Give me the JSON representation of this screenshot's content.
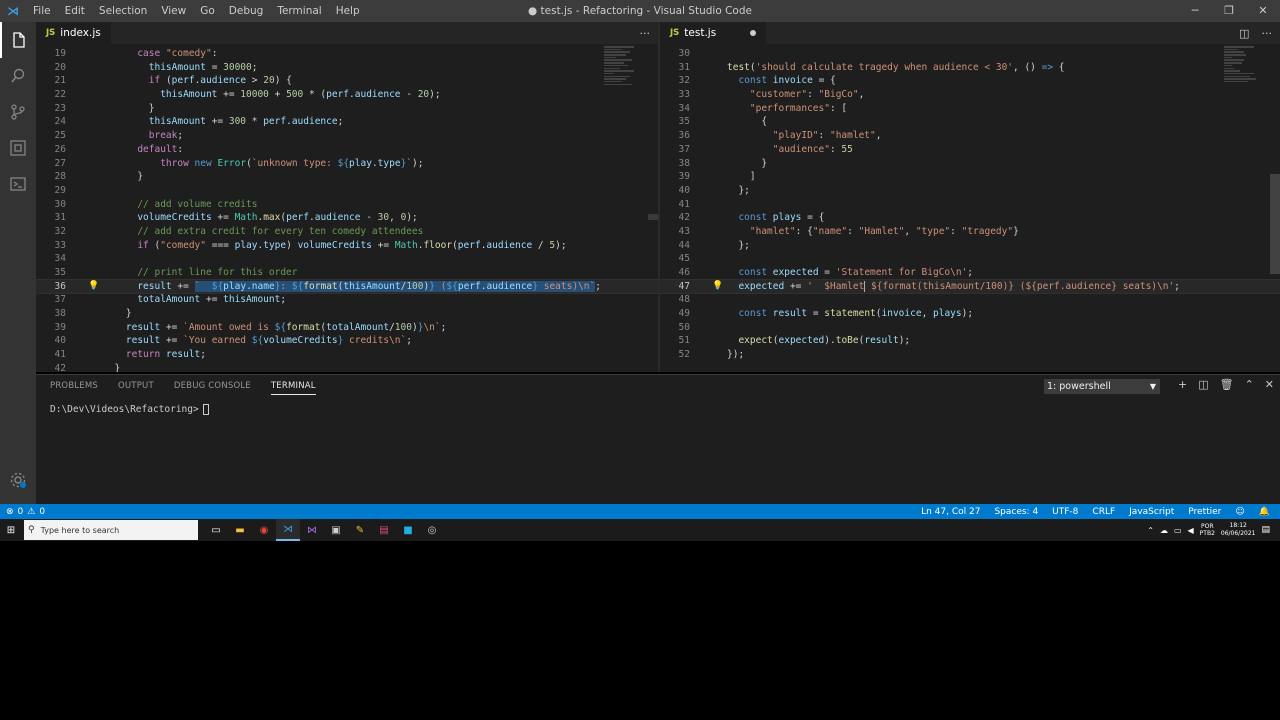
{
  "window": {
    "title": "● test.js - Refactoring - Visual Studio Code",
    "menu": [
      "File",
      "Edit",
      "Selection",
      "View",
      "Go",
      "Debug",
      "Terminal",
      "Help"
    ]
  },
  "activity_icons": [
    "files-icon",
    "search-icon",
    "source-control-icon",
    "extensions-icon",
    "remote-explorer-icon"
  ],
  "editor_left": {
    "tab_label": "index.js",
    "lines": [
      {
        "n": "19",
        "html": "      <span class=\"kw\">case</span> <span class=\"str\">\"comedy\"</span>:"
      },
      {
        "n": "20",
        "html": "        <span class=\"var\">thisAmount</span> = <span class=\"num2\">30000</span>;"
      },
      {
        "n": "21",
        "html": "        <span class=\"kw\">if</span> (<span class=\"var\">perf</span>.<span class=\"var\">audience</span> > <span class=\"num2\">20</span>) {"
      },
      {
        "n": "22",
        "html": "          <span class=\"var\">thisAmount</span> += <span class=\"num2\">10000</span> + <span class=\"num2\">500</span> * (<span class=\"var\">perf</span>.<span class=\"var\">audience</span> - <span class=\"num2\">20</span>);"
      },
      {
        "n": "23",
        "html": "        }"
      },
      {
        "n": "24",
        "html": "        <span class=\"var\">thisAmount</span> += <span class=\"num2\">300</span> * <span class=\"var\">perf</span>.<span class=\"var\">audience</span>;"
      },
      {
        "n": "25",
        "html": "        <span class=\"kw\">break</span>;"
      },
      {
        "n": "26",
        "html": "      <span class=\"kw\">default</span>:"
      },
      {
        "n": "27",
        "html": "          <span class=\"kw\">throw</span> <span class=\"kw2\">new</span> <span class=\"cls\">Error</span>(<span class=\"str\">`unknown type: </span><span class=\"kw2\">${</span><span class=\"var\">play</span>.<span class=\"var\">type</span><span class=\"kw2\">}</span><span class=\"str\">`</span>);"
      },
      {
        "n": "28",
        "html": "      }"
      },
      {
        "n": "29",
        "html": ""
      },
      {
        "n": "30",
        "html": "      <span class=\"com\">// add volume credits</span>"
      },
      {
        "n": "31",
        "html": "      <span class=\"var\">volumeCredits</span> += <span class=\"cls\">Math</span>.<span class=\"fn\">max</span>(<span class=\"var\">perf</span>.<span class=\"var\">audience</span> - <span class=\"num2\">30</span>, <span class=\"num2\">0</span>);"
      },
      {
        "n": "32",
        "html": "      <span class=\"com\">// add extra credit for every ten comedy attendees</span>"
      },
      {
        "n": "33",
        "html": "      <span class=\"kw\">if</span> (<span class=\"str\">\"comedy\"</span> === <span class=\"var\">play</span>.<span class=\"var\">type</span>) <span class=\"var\">volumeCredits</span> += <span class=\"cls\">Math</span>.<span class=\"fn\">floor</span>(<span class=\"var\">perf</span>.<span class=\"var\">audience</span> / <span class=\"num2\">5</span>);"
      },
      {
        "n": "34",
        "html": ""
      },
      {
        "n": "35",
        "html": "      <span class=\"com\">// print line for this order</span>"
      },
      {
        "n": "36",
        "html": "      <span class=\"var\">result</span> += <span class=\"sel\"><span class=\"str\">`  </span><span class=\"kw2\">${</span><span class=\"var\">play</span>.<span class=\"var\">name</span><span class=\"kw2\">}</span><span class=\"str\">: </span><span class=\"kw2\">${</span><span class=\"fn\">format</span>(<span class=\"var\">thisAmount</span>/<span class=\"num2\">100</span>)<span class=\"kw2\">}</span><span class=\"str\"> (</span><span class=\"kw2\">${</span><span class=\"var\">perf</span>.<span class=\"var\">audience</span><span class=\"kw2\">}</span><span class=\"str\"> seats)\\n`</span></span>;",
        "current": true,
        "bulb": true
      },
      {
        "n": "37",
        "html": "      <span class=\"var\">totalAmount</span> += <span class=\"var\">thisAmount</span>;"
      },
      {
        "n": "38",
        "html": "    }"
      },
      {
        "n": "39",
        "html": "    <span class=\"var\">result</span> += <span class=\"str\">`Amount owed is </span><span class=\"kw2\">${</span><span class=\"fn\">format</span>(<span class=\"var\">totalAmount</span>/<span class=\"num2\">100</span>)<span class=\"kw2\">}</span><span class=\"str\">\\n`</span>;"
      },
      {
        "n": "40",
        "html": "    <span class=\"var\">result</span> += <span class=\"str\">`You earned </span><span class=\"kw2\">${</span><span class=\"var\">volumeCredits</span><span class=\"kw2\">}</span><span class=\"str\"> credits\\n`</span>;"
      },
      {
        "n": "41",
        "html": "    <span class=\"kw\">return</span> <span class=\"var\">result</span>;"
      },
      {
        "n": "42",
        "html": "  }"
      }
    ]
  },
  "editor_right": {
    "tab_label": "test.js",
    "lines": [
      {
        "n": "30",
        "html": ""
      },
      {
        "n": "31",
        "html": "<span class=\"fn\">test</span>(<span class=\"str\">'should calculate tragedy when audience &lt; 30'</span>, () <span class=\"kw2\">=></span> {"
      },
      {
        "n": "32",
        "html": "  <span class=\"kw2\">const</span> <span class=\"var\">invoice</span> = {"
      },
      {
        "n": "33",
        "html": "    <span class=\"str\">\"customer\"</span>: <span class=\"str\">\"BigCo\"</span>,"
      },
      {
        "n": "34",
        "html": "    <span class=\"str\">\"performances\"</span>: ["
      },
      {
        "n": "35",
        "html": "      {"
      },
      {
        "n": "36",
        "html": "        <span class=\"str\">\"playID\"</span>: <span class=\"str\">\"hamlet\"</span>,"
      },
      {
        "n": "37",
        "html": "        <span class=\"str\">\"audience\"</span>: <span class=\"num2\">55</span>"
      },
      {
        "n": "38",
        "html": "      }"
      },
      {
        "n": "39",
        "html": "    ]"
      },
      {
        "n": "40",
        "html": "  };"
      },
      {
        "n": "41",
        "html": ""
      },
      {
        "n": "42",
        "html": "  <span class=\"kw2\">const</span> <span class=\"var\">plays</span> = {"
      },
      {
        "n": "43",
        "html": "    <span class=\"str\">\"hamlet\"</span>: {<span class=\"str\">\"name\"</span>: <span class=\"str\">\"Hamlet\"</span>, <span class=\"str\">\"type\"</span>: <span class=\"str\">\"tragedy\"</span>}"
      },
      {
        "n": "44",
        "html": "  };"
      },
      {
        "n": "45",
        "html": ""
      },
      {
        "n": "46",
        "html": "  <span class=\"kw2\">const</span> <span class=\"var\">expected</span> = <span class=\"str\">'Statement for BigCo\\n'</span>;"
      },
      {
        "n": "47",
        "html": "  <span class=\"var\">expected</span> += <span class=\"str\">'  $Hamlet</span><span style=\"border-left:1px solid #aeafad\"></span><span class=\"str\"> ${format(thisAmount/100)} (${perf.audience} seats)\\n'</span>;",
        "current": true,
        "bulb": true
      },
      {
        "n": "48",
        "html": ""
      },
      {
        "n": "49",
        "html": "  <span class=\"kw2\">const</span> <span class=\"var\">result</span> = <span class=\"fn\">statement</span>(<span class=\"var\">invoice</span>, <span class=\"var\">plays</span>);"
      },
      {
        "n": "50",
        "html": ""
      },
      {
        "n": "51",
        "html": "  <span class=\"fn\">expect</span>(<span class=\"var\">expected</span>).<span class=\"fn\">toBe</span>(<span class=\"var\">result</span>);"
      },
      {
        "n": "52",
        "html": "});"
      }
    ]
  },
  "panel": {
    "tabs": [
      "PROBLEMS",
      "OUTPUT",
      "DEBUG CONSOLE",
      "TERMINAL"
    ],
    "active_tab": "TERMINAL",
    "terminal_select": "1: powershell",
    "prompt": "D:\\Dev\\Videos\\Refactoring>"
  },
  "status": {
    "errors": "0",
    "warnings": "0",
    "position": "Ln 47, Col 27",
    "spaces": "Spaces: 4",
    "encoding": "UTF-8",
    "eol": "CRLF",
    "language": "JavaScript",
    "formatter": "Prettier"
  },
  "taskbar": {
    "search_placeholder": "Type here to search",
    "lang_top": "POR",
    "lang_bottom": "PTB2",
    "time": "18:12",
    "date": "06/06/2021"
  },
  "colors": {
    "status_bar": "#007acc",
    "editor_bg": "#1e1e1e",
    "title_bar": "#3c3c3c",
    "activity_bar": "#333333"
  }
}
